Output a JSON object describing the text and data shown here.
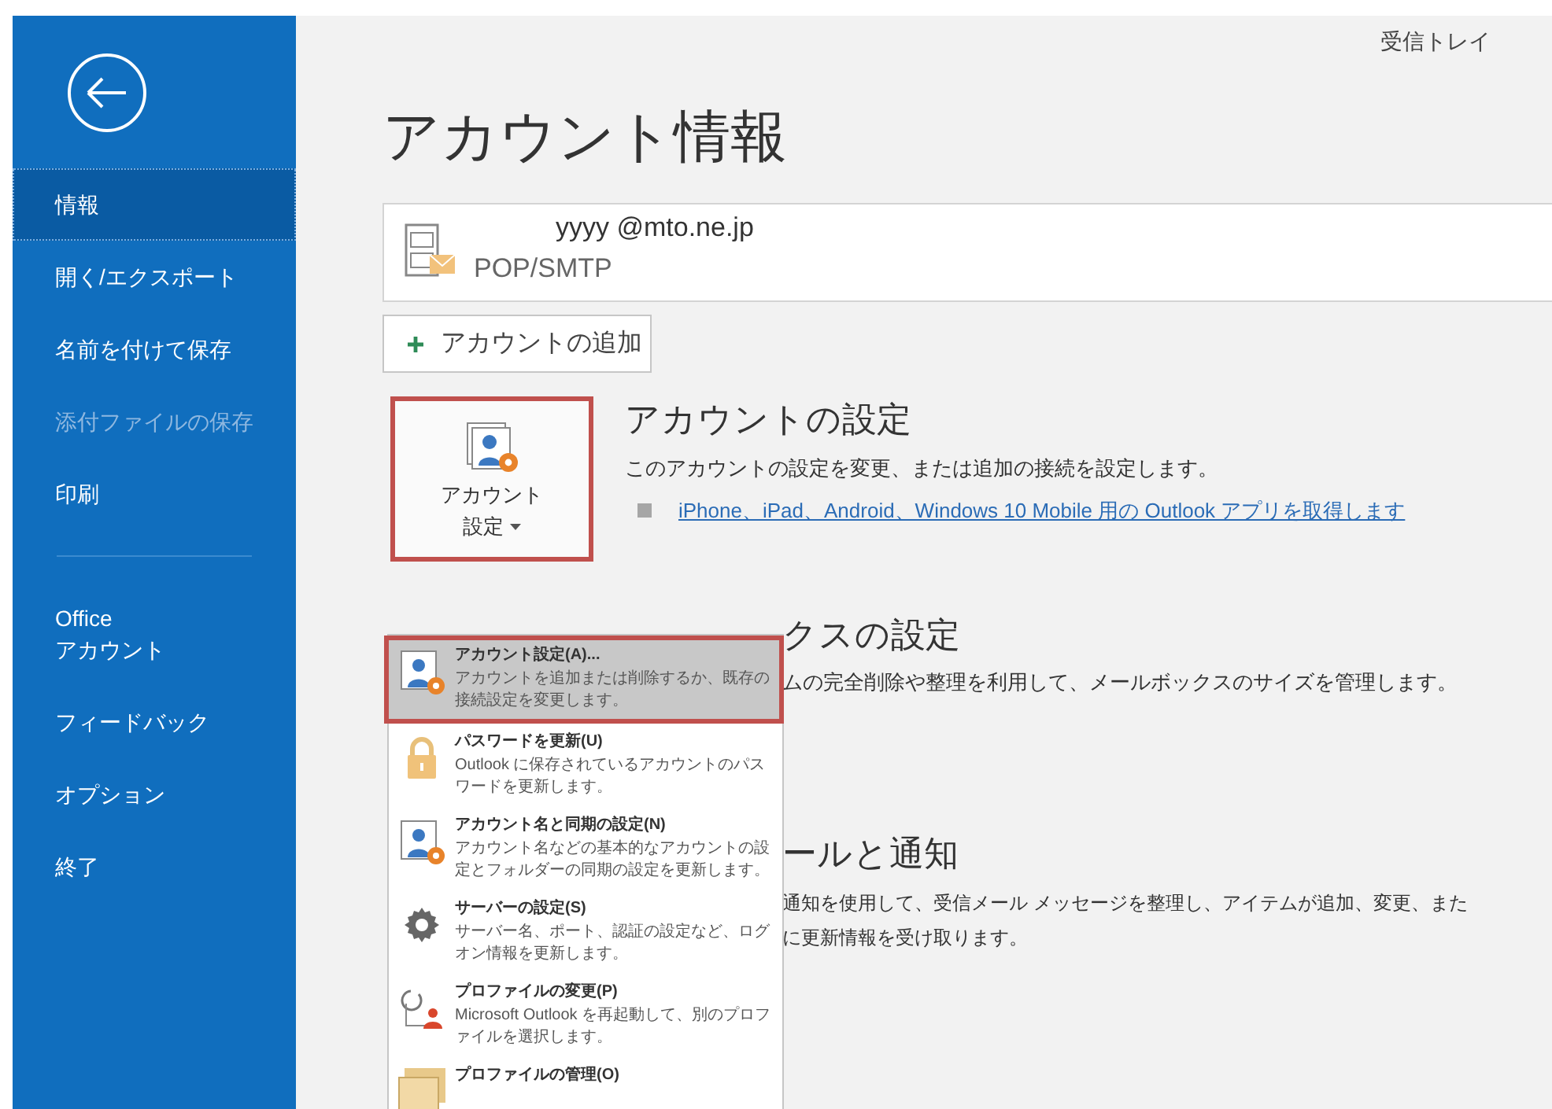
{
  "sidebar": {
    "items": [
      {
        "label": "情報",
        "selected": true,
        "disabled": false
      },
      {
        "label": "開く/エクスポート",
        "selected": false,
        "disabled": false
      },
      {
        "label": "名前を付けて保存",
        "selected": false,
        "disabled": false
      },
      {
        "label": "添付ファイルの保存",
        "selected": false,
        "disabled": true
      },
      {
        "label": "印刷",
        "selected": false,
        "disabled": false
      }
    ],
    "lower_items": [
      {
        "label": "Office\nアカウント",
        "selected": false,
        "disabled": false
      },
      {
        "label": "フィードバック",
        "selected": false,
        "disabled": false
      },
      {
        "label": "オプション",
        "selected": false,
        "disabled": false
      },
      {
        "label": "終了",
        "selected": false,
        "disabled": false
      }
    ]
  },
  "folder_label": "受信トレイ",
  "title": "アカウント情報",
  "account": {
    "email": "yyyy @mto.ne.jp",
    "type": "POP/SMTP"
  },
  "add_account_button": "アカウントの追加",
  "account_settings": {
    "button_label_lines": [
      "アカウント",
      "設定"
    ],
    "heading": "アカウントの設定",
    "description": "このアカウントの設定を変更、または追加の接続を設定します。",
    "link": "iPhone、iPad、Android、Windows 10 Mobile 用の Outlook アプリを取得します"
  },
  "menu": [
    {
      "kind": "person-gear",
      "title": "アカウント設定(A)...",
      "description": "アカウントを追加または削除するか、既存の接続設定を変更します。",
      "selected": true
    },
    {
      "kind": "lock",
      "title": "パスワードを更新(U)",
      "description": "Outlook に保存されているアカウントのパスワードを更新します。",
      "selected": false
    },
    {
      "kind": "person-gear",
      "title": "アカウント名と同期の設定(N)",
      "description": "アカウント名などの基本的なアカウントの設定とフォルダーの同期の設定を更新します。",
      "selected": false
    },
    {
      "kind": "gear",
      "title": "サーバーの設定(S)",
      "description": "サーバー名、ポート、認証の設定など、ログオン情報を更新します。",
      "selected": false
    },
    {
      "kind": "profile-switch",
      "title": "プロファイルの変更(P)",
      "description": "Microsoft Outlook を再起動して、別のプロファイルを選択します。",
      "selected": false
    },
    {
      "kind": "folders",
      "title": "プロファイルの管理(O)",
      "selected": false
    }
  ],
  "mailbox_section": {
    "heading": "クスの設定",
    "description": "ムの完全削除や整理を利用して、メールボックスのサイズを管理します。"
  },
  "rules_section": {
    "heading": "ールと通知",
    "lines": [
      "通知を使用して、受信メール メッセージを整理し、アイテムが追加、変更、また",
      "に更新情報を受け取ります。"
    ]
  }
}
